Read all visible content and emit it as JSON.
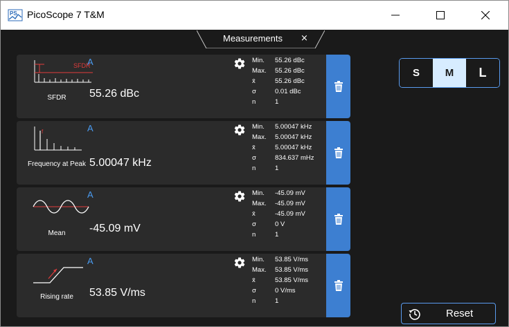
{
  "window": {
    "title": "PicoScope 7 T&M"
  },
  "tab": {
    "label": "Measurements",
    "close_glyph": "×"
  },
  "sizes": {
    "options": [
      "S",
      "M",
      "L"
    ],
    "selected": "M"
  },
  "reset": {
    "label": "Reset"
  },
  "colors": {
    "accent": "#3d7fd1",
    "channel": "#4a9bf0",
    "thumb_red": "#e03c3c",
    "background": "#1a1a1a",
    "card": "#2b2b2b"
  },
  "measurements": [
    {
      "channel": "A",
      "name": "SFDR",
      "value": "55.26 dBc",
      "thumb_icon": "sfdr-icon",
      "thumb_label": "SFDR",
      "stats": [
        {
          "key": "Min.",
          "value": "55.26 dBc"
        },
        {
          "key": "Max.",
          "value": "55.26 dBc"
        },
        {
          "key": "x̄",
          "value": "55.26 dBc"
        },
        {
          "key": "σ",
          "value": "0.01 dBc"
        },
        {
          "key": "n",
          "value": "1"
        }
      ]
    },
    {
      "channel": "A",
      "name": "Frequency at Peak",
      "value": "5.00047 kHz",
      "thumb_icon": "frequency-peak-icon",
      "stats": [
        {
          "key": "Min.",
          "value": "5.00047 kHz"
        },
        {
          "key": "Max.",
          "value": "5.00047 kHz"
        },
        {
          "key": "x̄",
          "value": "5.00047 kHz"
        },
        {
          "key": "σ",
          "value": "834.637 mHz"
        },
        {
          "key": "n",
          "value": "1"
        }
      ]
    },
    {
      "channel": "A",
      "name": "Mean",
      "value": "-45.09 mV",
      "thumb_icon": "sine-wave-icon",
      "stats": [
        {
          "key": "Min.",
          "value": "-45.09 mV"
        },
        {
          "key": "Max.",
          "value": "-45.09 mV"
        },
        {
          "key": "x̄",
          "value": "-45.09 mV"
        },
        {
          "key": "σ",
          "value": "0 V"
        },
        {
          "key": "n",
          "value": "1"
        }
      ]
    },
    {
      "channel": "A",
      "name": "Rising rate",
      "value": "53.85 V/ms",
      "thumb_icon": "rising-edge-icon",
      "stats": [
        {
          "key": "Min.",
          "value": "53.85 V/ms"
        },
        {
          "key": "Max.",
          "value": "53.85 V/ms"
        },
        {
          "key": "x̄",
          "value": "53.85 V/ms"
        },
        {
          "key": "σ",
          "value": "0 V/ms"
        },
        {
          "key": "n",
          "value": "1"
        }
      ]
    }
  ]
}
